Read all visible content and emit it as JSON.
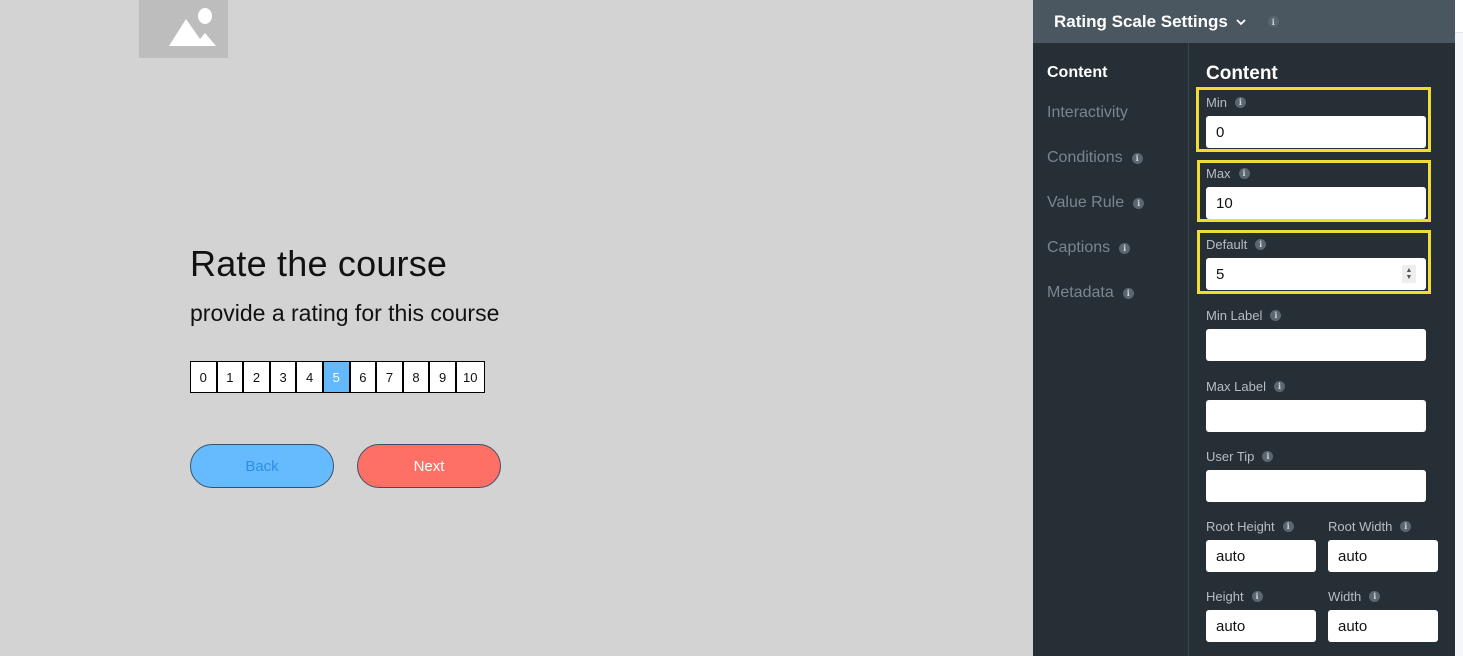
{
  "stage": {
    "image_placeholder": "image-icon",
    "title": "Rate the course",
    "subtitle": "provide a rating for this course",
    "rating_scale": {
      "min": 0,
      "max": 10,
      "selected": 5,
      "options": [
        "0",
        "1",
        "2",
        "3",
        "4",
        "5",
        "6",
        "7",
        "8",
        "9",
        "10"
      ]
    },
    "buttons": {
      "back": "Back",
      "next": "Next"
    },
    "colors": {
      "selected_cell": "#64b9fc",
      "back_button": "#66bbff",
      "next_button": "#fe7066"
    }
  },
  "panel": {
    "title": "Rating Scale Settings",
    "title_icon": "chevron-down-icon",
    "info_glyph": "i",
    "nav": [
      {
        "label": "Content",
        "active": true,
        "info": false
      },
      {
        "label": "Interactivity",
        "active": false,
        "info": false
      },
      {
        "label": "Conditions",
        "active": false,
        "info": true
      },
      {
        "label": "Value Rule",
        "active": false,
        "info": true
      },
      {
        "label": "Captions",
        "active": false,
        "info": true
      },
      {
        "label": "Metadata",
        "active": false,
        "info": true
      }
    ],
    "form": {
      "heading": "Content",
      "fields": {
        "min": {
          "label": "Min",
          "value": "0"
        },
        "max": {
          "label": "Max",
          "value": "10"
        },
        "default": {
          "label": "Default",
          "value": "5"
        },
        "min_label": {
          "label": "Min Label",
          "value": ""
        },
        "max_label": {
          "label": "Max Label",
          "value": ""
        },
        "user_tip": {
          "label": "User Tip",
          "value": ""
        },
        "root_height": {
          "label": "Root Height",
          "value": "auto"
        },
        "root_width": {
          "label": "Root Width",
          "value": "auto"
        },
        "height": {
          "label": "Height",
          "value": "auto"
        },
        "width": {
          "label": "Width",
          "value": "auto"
        }
      }
    },
    "colors": {
      "highlight": "#f0dc34",
      "panel_bg": "#262f36",
      "header_bg": "#4a5660"
    }
  }
}
